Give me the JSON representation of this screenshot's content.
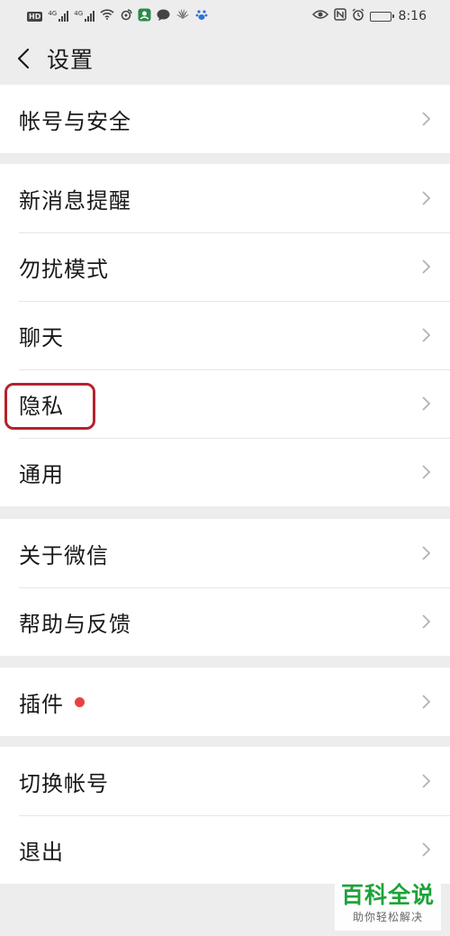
{
  "status_bar": {
    "hd": "HD",
    "net1": "4G",
    "net2": "4G",
    "time": "8:16"
  },
  "nav": {
    "title": "设置"
  },
  "groups": [
    {
      "items": [
        {
          "label": "帐号与安全"
        }
      ]
    },
    {
      "items": [
        {
          "label": "新消息提醒"
        },
        {
          "label": "勿扰模式"
        },
        {
          "label": "聊天"
        },
        {
          "label": "隐私"
        },
        {
          "label": "通用"
        }
      ]
    },
    {
      "items": [
        {
          "label": "关于微信"
        },
        {
          "label": "帮助与反馈"
        }
      ]
    },
    {
      "items": [
        {
          "label": "插件"
        }
      ]
    },
    {
      "items": [
        {
          "label": "切换帐号"
        },
        {
          "label": "退出"
        }
      ]
    }
  ],
  "watermark": {
    "main": "百科全说",
    "sub": "助你轻松解决"
  },
  "colors": {
    "background": "#ededed",
    "red_dot": "#e64340",
    "highlight": "#b5232c",
    "watermark_green": "#1ea33a"
  }
}
